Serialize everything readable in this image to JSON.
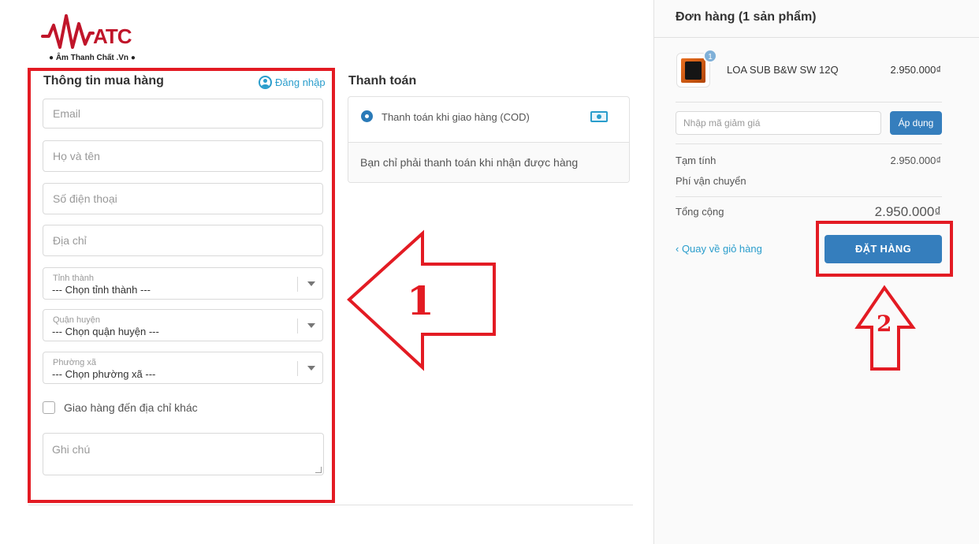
{
  "logo": {
    "brand": "ATC",
    "tagline": "● Âm Thanh Chất .Vn ●"
  },
  "customer_info": {
    "title": "Thông tin mua hàng",
    "login_label": "Đăng nhập",
    "email_placeholder": "Email",
    "name_placeholder": "Họ và tên",
    "phone_placeholder": "Số điện thoại",
    "address_placeholder": "Địa chỉ",
    "province": {
      "label": "Tỉnh thành",
      "value": "--- Chọn tỉnh thành ---"
    },
    "district": {
      "label": "Quận huyện",
      "value": "--- Chọn quận huyện ---"
    },
    "ward": {
      "label": "Phường xã",
      "value": "--- Chọn phường xã ---"
    },
    "ship_other_label": "Giao hàng đến địa chỉ khác",
    "note_placeholder": "Ghi chú"
  },
  "payment": {
    "title": "Thanh toán",
    "option_label": "Thanh toán khi giao hàng (COD)",
    "description": "Bạn chỉ phải thanh toán khi nhận được hàng"
  },
  "order": {
    "title": "Đơn hàng (1 sản phẩm)",
    "item": {
      "name": "LOA SUB B&W SW 12Q",
      "price": "2.950.000₫",
      "quantity": "1"
    },
    "coupon_placeholder": "Nhập mã giảm giá",
    "apply_label": "Áp dụng",
    "subtotal_label": "Tạm tính",
    "subtotal_value": "2.950.000₫",
    "shipping_label": "Phí vận chuyển",
    "total_label": "Tổng cộng",
    "total_value": "2.950.000₫",
    "back_label": "‹ Quay về giỏ hàng",
    "place_order_label": "ĐẶT HÀNG"
  },
  "annotations": {
    "step1": "1",
    "step2": "2",
    "color": "#e31b23"
  },
  "colors": {
    "brand_red": "#c0152a",
    "link": "#2a9dcc",
    "button": "#357ebd"
  }
}
